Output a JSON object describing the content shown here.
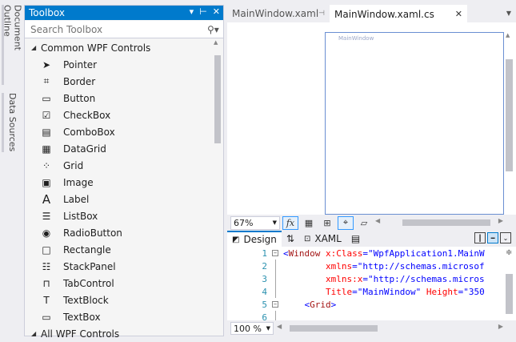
{
  "side_tabs": [
    "Document Outline",
    "Data Sources"
  ],
  "toolbox": {
    "title": "Toolbox",
    "search_placeholder": "Search Toolbox",
    "group1": "Common WPF Controls",
    "items": [
      {
        "label": "Pointer",
        "icon": "pointer-icon"
      },
      {
        "label": "Border",
        "icon": "border-icon"
      },
      {
        "label": "Button",
        "icon": "button-icon"
      },
      {
        "label": "CheckBox",
        "icon": "checkbox-icon"
      },
      {
        "label": "ComboBox",
        "icon": "combobox-icon"
      },
      {
        "label": "DataGrid",
        "icon": "datagrid-icon"
      },
      {
        "label": "Grid",
        "icon": "grid-icon"
      },
      {
        "label": "Image",
        "icon": "image-icon"
      },
      {
        "label": "Label",
        "icon": "label-icon"
      },
      {
        "label": "ListBox",
        "icon": "listbox-icon"
      },
      {
        "label": "RadioButton",
        "icon": "radiobutton-icon"
      },
      {
        "label": "Rectangle",
        "icon": "rectangle-icon"
      },
      {
        "label": "StackPanel",
        "icon": "stackpanel-icon"
      },
      {
        "label": "TabControl",
        "icon": "tabcontrol-icon"
      },
      {
        "label": "TextBlock",
        "icon": "textblock-icon"
      },
      {
        "label": "TextBox",
        "icon": "textbox-icon"
      }
    ],
    "group2": "All WPF Controls"
  },
  "tabs": [
    {
      "label": "MainWindow.xaml",
      "active": false
    },
    {
      "label": "MainWindow.xaml.cs",
      "active": true
    }
  ],
  "designer": {
    "window_title": "MainWindow",
    "zoom": "67%"
  },
  "split": {
    "design_label": "Design",
    "xaml_label": "XAML"
  },
  "code": {
    "lines": [
      {
        "n": "1",
        "text": "<Window x:Class=\"WpfApplication1.MainW"
      },
      {
        "n": "2",
        "text": "xmlns=\"http://schemas.microsof"
      },
      {
        "n": "3",
        "text": "xmlns:x=\"http://schemas.micros"
      },
      {
        "n": "4",
        "text": "Title=\"MainWindow\" Height=\"350"
      },
      {
        "n": "5",
        "text": "<Grid>"
      },
      {
        "n": "6",
        "text": ""
      }
    ],
    "zoom": "100 %"
  },
  "colors": {
    "accent": "#007acc",
    "xaml_tag": "#a31515",
    "xaml_attr": "#ff0000",
    "xaml_value": "#0000ff",
    "line_number": "#2b91af"
  }
}
